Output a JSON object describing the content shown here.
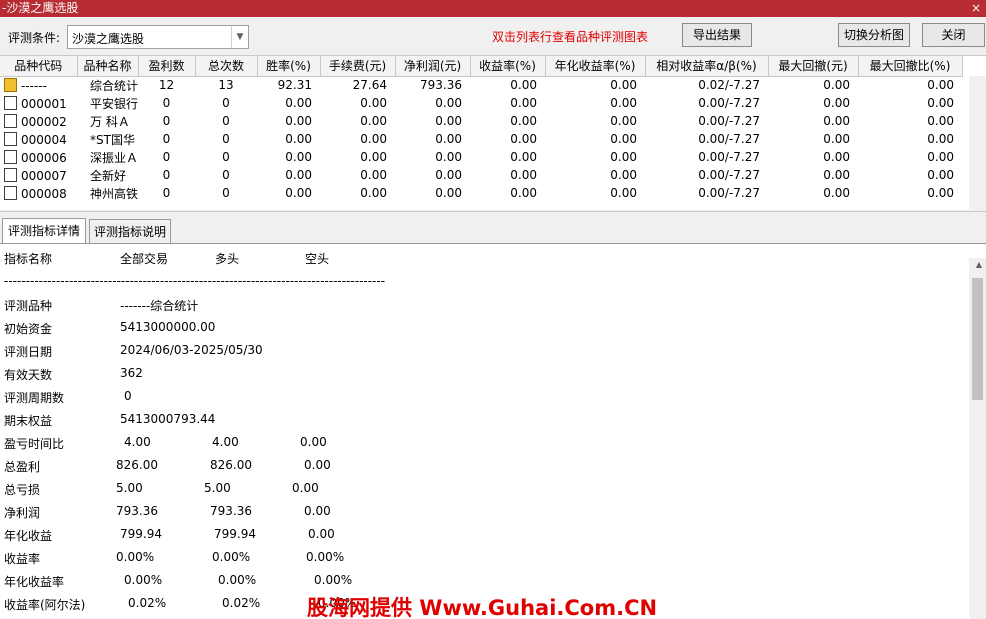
{
  "window": {
    "title": "-沙漠之鹰选股",
    "close_glyph": "×"
  },
  "toolbar": {
    "condition_label": "评测条件:",
    "condition_value": "沙漠之鹰选股",
    "hint": "双击列表行查看品种评测图表",
    "export_label": "导出结果",
    "switch_label": "切换分析图",
    "close_label": "关闭"
  },
  "table": {
    "columns": [
      "品种代码",
      "品种名称",
      "盈利数",
      "总次数",
      "胜率(%)",
      "手续费(元)",
      "净利润(元)",
      "收益率(%)",
      "年化收益率(%)",
      "相对收益率α/β(%)",
      "最大回撤(元)",
      "最大回撤比(%)"
    ],
    "rows": [
      {
        "icon": "folder-icon",
        "code": "------",
        "name": "综合统计",
        "win": "12",
        "total": "13",
        "rate": "92.31",
        "fee": "27.64",
        "profit": "793.36",
        "ret": "0.00",
        "annual": "0.00",
        "alpha": "0.02/-7.27",
        "maxdd": "0.00",
        "maxddr": "0.00"
      },
      {
        "icon": "document-icon",
        "code": "000001",
        "name": "平安银行",
        "win": "0",
        "total": "0",
        "rate": "0.00",
        "fee": "0.00",
        "profit": "0.00",
        "ret": "0.00",
        "annual": "0.00",
        "alpha": "0.00/-7.27",
        "maxdd": "0.00",
        "maxddr": "0.00"
      },
      {
        "icon": "document-icon",
        "code": "000002",
        "name": "万 科Ａ",
        "win": "0",
        "total": "0",
        "rate": "0.00",
        "fee": "0.00",
        "profit": "0.00",
        "ret": "0.00",
        "annual": "0.00",
        "alpha": "0.00/-7.27",
        "maxdd": "0.00",
        "maxddr": "0.00"
      },
      {
        "icon": "document-icon",
        "code": "000004",
        "name": "*ST国华",
        "win": "0",
        "total": "0",
        "rate": "0.00",
        "fee": "0.00",
        "profit": "0.00",
        "ret": "0.00",
        "annual": "0.00",
        "alpha": "0.00/-7.27",
        "maxdd": "0.00",
        "maxddr": "0.00"
      },
      {
        "icon": "document-icon",
        "code": "000006",
        "name": "深振业Ａ",
        "win": "0",
        "total": "0",
        "rate": "0.00",
        "fee": "0.00",
        "profit": "0.00",
        "ret": "0.00",
        "annual": "0.00",
        "alpha": "0.00/-7.27",
        "maxdd": "0.00",
        "maxddr": "0.00"
      },
      {
        "icon": "document-icon",
        "code": "000007",
        "name": "全新好",
        "win": "0",
        "total": "0",
        "rate": "0.00",
        "fee": "0.00",
        "profit": "0.00",
        "ret": "0.00",
        "annual": "0.00",
        "alpha": "0.00/-7.27",
        "maxdd": "0.00",
        "maxddr": "0.00"
      },
      {
        "icon": "document-icon",
        "code": "000008",
        "name": "神州高铁",
        "win": "0",
        "total": "0",
        "rate": "0.00",
        "fee": "0.00",
        "profit": "0.00",
        "ret": "0.00",
        "annual": "0.00",
        "alpha": "0.00/-7.27",
        "maxdd": "0.00",
        "maxddr": "0.00"
      }
    ]
  },
  "tabs": {
    "detail": "评测指标详情",
    "explain": "评测指标说明"
  },
  "detail": {
    "header": {
      "name": "指标名称",
      "all": "全部交易",
      "long": "多头",
      "short": "空头"
    },
    "separator": "----------------------------------------------------------------------------------------",
    "rows": [
      {
        "label": "评测品种",
        "all": "-------综合统计",
        "long": "",
        "short": ""
      },
      {
        "label": "初始资金",
        "all": "5413000000.00",
        "long": "",
        "short": ""
      },
      {
        "label": "评测日期",
        "all": "2024/06/03-2025/05/30",
        "long": "",
        "short": ""
      },
      {
        "label": "有效天数",
        "all": "362",
        "long": "",
        "short": ""
      },
      {
        "label": "评测周期数",
        "all": "0",
        "long": "",
        "short": ""
      },
      {
        "label": "期末权益",
        "all": "5413000793.44",
        "long": "",
        "short": ""
      },
      {
        "label": "盈亏时间比",
        "all": "4.00",
        "long": "4.00",
        "short": "0.00"
      },
      {
        "label": "总盈利",
        "all": "826.00",
        "long": "826.00",
        "short": "0.00"
      },
      {
        "label": "总亏损",
        "all": "5.00",
        "long": "5.00",
        "short": "0.00"
      },
      {
        "label": "净利润",
        "all": "793.36",
        "long": "793.36",
        "short": "0.00"
      },
      {
        "label": "年化收益",
        "all": "799.94",
        "long": "799.94",
        "short": "0.00"
      },
      {
        "label": "收益率",
        "all": "0.00%",
        "long": "0.00%",
        "short": "0.00%"
      },
      {
        "label": "年化收益率",
        "all": "0.00%",
        "long": "0.00%",
        "short": "0.00%"
      },
      {
        "label": "收益率(阿尔法)",
        "all": "0.02%",
        "long": "0.02%",
        "short": "0.00%"
      }
    ]
  },
  "watermark": "股海网提供 Www.Guhai.Com.CN"
}
